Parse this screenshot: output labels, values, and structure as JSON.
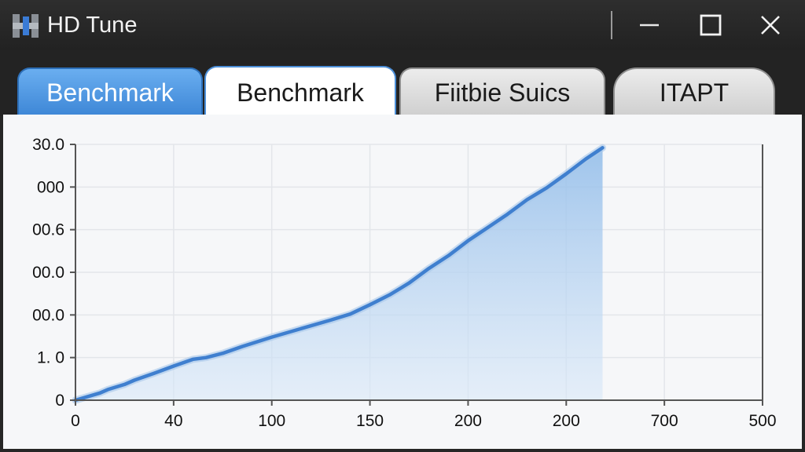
{
  "window": {
    "title": "HD Tune",
    "icons": {
      "app": "hd-tune-app-icon",
      "minimize": "minimize-icon",
      "maximize": "maximize-icon",
      "close": "close-icon"
    }
  },
  "tabs": [
    {
      "label": "Benchmark",
      "state": "highlighted"
    },
    {
      "label": "Benchmark",
      "state": "active"
    },
    {
      "label": "Fiitbie Suics",
      "state": "inactive"
    },
    {
      "label": "ITAPT",
      "state": "inactive"
    }
  ],
  "colors": {
    "tab_highlight": "#4a90e2",
    "line": "#3f7fcf",
    "fill": "#a9c9ec"
  },
  "chart_data": {
    "type": "area",
    "x_tick_labels": [
      "0",
      "40",
      "100",
      "150",
      "200",
      "200",
      "700",
      "500"
    ],
    "y_tick_labels": [
      "0",
      "1. 0",
      "00.0",
      "00.0",
      "00.6",
      "000",
      "30.0"
    ],
    "grid": true,
    "series": [
      {
        "values": [
          0.0,
          0.17,
          0.25,
          0.37,
          0.47,
          0.63,
          0.8,
          0.96,
          1.0,
          1.1,
          1.26,
          1.48,
          1.68,
          1.88,
          2.02,
          2.24,
          2.47,
          2.75,
          3.09,
          3.39,
          3.74,
          4.05,
          4.36,
          4.7,
          4.98,
          5.31,
          5.66,
          5.92
        ],
        "positions": [
          0,
          0.25,
          0.33,
          0.5,
          0.6,
          0.8,
          1.0,
          1.2,
          1.33,
          1.5,
          1.7,
          2.0,
          2.3,
          2.6,
          2.8,
          3.0,
          3.2,
          3.4,
          3.6,
          3.8,
          4.0,
          4.2,
          4.4,
          4.6,
          4.8,
          5.0,
          5.2,
          5.37
        ]
      }
    ]
  }
}
